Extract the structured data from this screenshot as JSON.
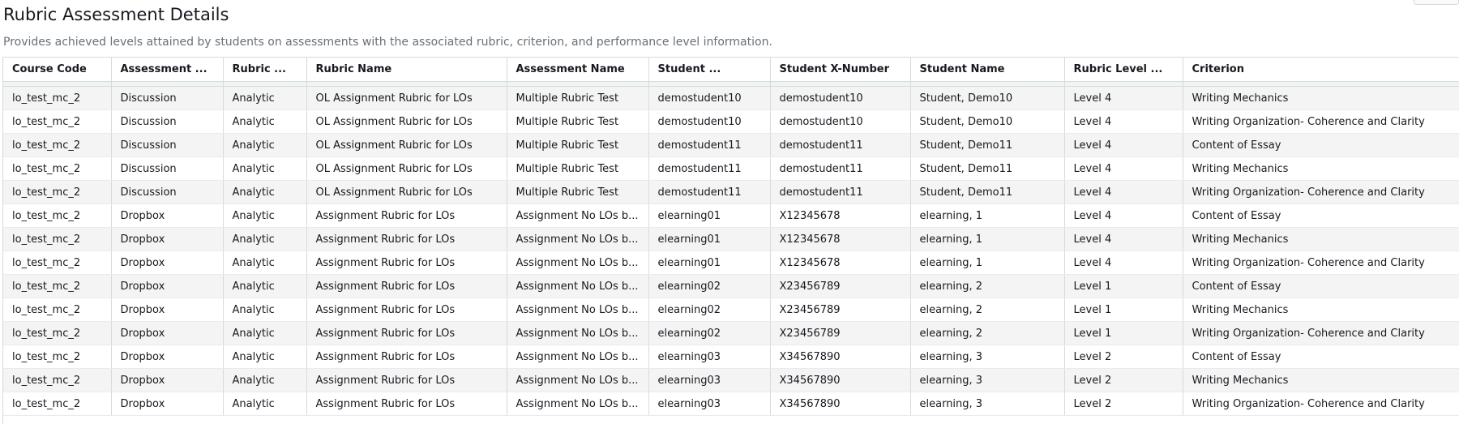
{
  "page": {
    "title": "Rubric Assessment Details",
    "subtitle": "Provides achieved levels attained by students on assessments with the associated rubric, criterion, and performance level information."
  },
  "table": {
    "columns": [
      "Course Code",
      "Assessment ...",
      "Rubric ...",
      "Rubric Name",
      "Assessment Name",
      "Student ...",
      "Student X-Number",
      "Student Name",
      "Rubric Level ...",
      "Criterion"
    ],
    "rows": [
      [
        "lo_test_mc_2",
        "Discussion",
        "Analytic",
        "OL Assignment Rubric for LOs",
        "Multiple Rubric Test",
        "demostudent10",
        "demostudent10",
        "Student, Demo10",
        "Level 4",
        "Writing Mechanics"
      ],
      [
        "lo_test_mc_2",
        "Discussion",
        "Analytic",
        "OL Assignment Rubric for LOs",
        "Multiple Rubric Test",
        "demostudent10",
        "demostudent10",
        "Student, Demo10",
        "Level 4",
        "Writing Organization- Coherence and Clarity"
      ],
      [
        "lo_test_mc_2",
        "Discussion",
        "Analytic",
        "OL Assignment Rubric for LOs",
        "Multiple Rubric Test",
        "demostudent11",
        "demostudent11",
        "Student, Demo11",
        "Level 4",
        "Content of Essay"
      ],
      [
        "lo_test_mc_2",
        "Discussion",
        "Analytic",
        "OL Assignment Rubric for LOs",
        "Multiple Rubric Test",
        "demostudent11",
        "demostudent11",
        "Student, Demo11",
        "Level 4",
        "Writing Mechanics"
      ],
      [
        "lo_test_mc_2",
        "Discussion",
        "Analytic",
        "OL Assignment Rubric for LOs",
        "Multiple Rubric Test",
        "demostudent11",
        "demostudent11",
        "Student, Demo11",
        "Level 4",
        "Writing Organization- Coherence and Clarity"
      ],
      [
        "lo_test_mc_2",
        "Dropbox",
        "Analytic",
        "Assignment Rubric for LOs",
        "Assignment No LOs b...",
        "elearning01",
        "X12345678",
        "elearning, 1",
        "Level 4",
        "Content of Essay"
      ],
      [
        "lo_test_mc_2",
        "Dropbox",
        "Analytic",
        "Assignment Rubric for LOs",
        "Assignment No LOs b...",
        "elearning01",
        "X12345678",
        "elearning, 1",
        "Level 4",
        "Writing Mechanics"
      ],
      [
        "lo_test_mc_2",
        "Dropbox",
        "Analytic",
        "Assignment Rubric for LOs",
        "Assignment No LOs b...",
        "elearning01",
        "X12345678",
        "elearning, 1",
        "Level 4",
        "Writing Organization- Coherence and Clarity"
      ],
      [
        "lo_test_mc_2",
        "Dropbox",
        "Analytic",
        "Assignment Rubric for LOs",
        "Assignment No LOs b...",
        "elearning02",
        "X23456789",
        "elearning, 2",
        "Level 1",
        "Content of Essay"
      ],
      [
        "lo_test_mc_2",
        "Dropbox",
        "Analytic",
        "Assignment Rubric for LOs",
        "Assignment No LOs b...",
        "elearning02",
        "X23456789",
        "elearning, 2",
        "Level 1",
        "Writing Mechanics"
      ],
      [
        "lo_test_mc_2",
        "Dropbox",
        "Analytic",
        "Assignment Rubric for LOs",
        "Assignment No LOs b...",
        "elearning02",
        "X23456789",
        "elearning, 2",
        "Level 1",
        "Writing Organization- Coherence and Clarity"
      ],
      [
        "lo_test_mc_2",
        "Dropbox",
        "Analytic",
        "Assignment Rubric for LOs",
        "Assignment No LOs b...",
        "elearning03",
        "X34567890",
        "elearning, 3",
        "Level 2",
        "Content of Essay"
      ],
      [
        "lo_test_mc_2",
        "Dropbox",
        "Analytic",
        "Assignment Rubric for LOs",
        "Assignment No LOs b...",
        "elearning03",
        "X34567890",
        "elearning, 3",
        "Level 2",
        "Writing Mechanics"
      ],
      [
        "lo_test_mc_2",
        "Dropbox",
        "Analytic",
        "Assignment Rubric for LOs",
        "Assignment No LOs b...",
        "elearning03",
        "X34567890",
        "elearning, 3",
        "Level 2",
        "Writing Organization- Coherence and Clarity"
      ]
    ]
  }
}
